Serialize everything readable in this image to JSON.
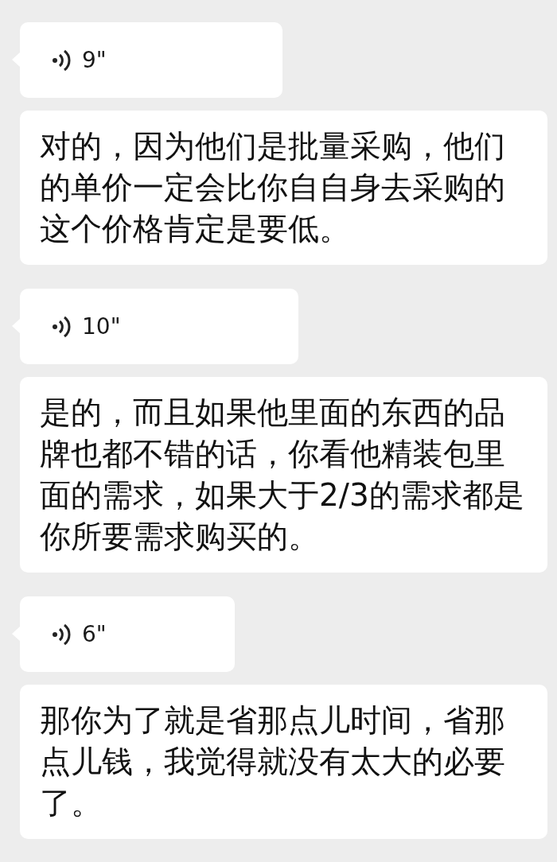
{
  "messages": [
    {
      "kind": "voice",
      "duration": "9\""
    },
    {
      "kind": "text",
      "text": "对的，因为他们是批量采购，他们的单价一定会比你自自身去采购的这个价格肯定是要低。"
    },
    {
      "kind": "voice",
      "duration": "10\""
    },
    {
      "kind": "text",
      "text": "是的，而且如果他里面的东西的品牌也都不错的话，你看他精装包里面的需求，如果大于2/3的需求都是你所要需求购买的。"
    },
    {
      "kind": "voice",
      "duration": "6\""
    },
    {
      "kind": "text",
      "text": "那你为了就是省那点儿时间，省那点儿钱，我觉得就没有太大的必要了。"
    }
  ]
}
